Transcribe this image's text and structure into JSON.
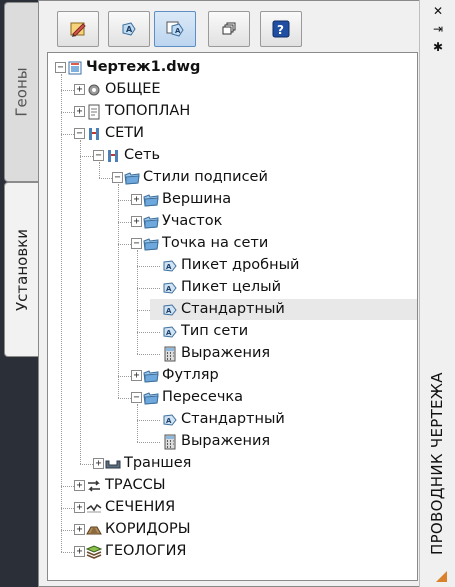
{
  "window": {
    "caption": "ПРОВОДНИК ЧЕРТЕЖА",
    "close_symbol": "✕",
    "autohide_symbol": "⇥",
    "properties_symbol": "✱"
  },
  "side_tabs": [
    {
      "label": "Геоны",
      "active": false
    },
    {
      "label": "Установки",
      "active": true
    }
  ],
  "toolbar": [
    {
      "name": "edit-settings-button",
      "icon": "pencil-drawing-icon",
      "active": false
    },
    {
      "name": "edit-label-style-button",
      "icon": "label-style-icon",
      "active": false
    },
    {
      "name": "label-style-tree-button",
      "icon": "label-style-tree-icon",
      "active": true
    },
    {
      "name": "copy-style-button",
      "icon": "copy-windows-icon",
      "active": false
    },
    {
      "name": "help-button",
      "icon": "help-icon",
      "active": false
    }
  ],
  "tree": {
    "items": [
      {
        "label": "Чертеж1.dwg",
        "level": 0,
        "icon": "drawing-icon",
        "state": "open",
        "bold": true
      },
      {
        "label": "ОБЩЕЕ",
        "level": 1,
        "icon": "gear-icon",
        "state": "closed"
      },
      {
        "label": "ТОПОПЛАН",
        "level": 1,
        "icon": "topoplan-icon",
        "state": "closed"
      },
      {
        "label": "СЕТИ",
        "level": 1,
        "icon": "network-icon",
        "state": "open"
      },
      {
        "label": "Сеть",
        "level": 2,
        "icon": "network-icon",
        "state": "open"
      },
      {
        "label": "Стили подписей",
        "level": 3,
        "icon": "folder-icon",
        "state": "open"
      },
      {
        "label": "Вершина",
        "level": 4,
        "icon": "folder-icon",
        "state": "closed"
      },
      {
        "label": "Участок",
        "level": 4,
        "icon": "folder-icon",
        "state": "closed"
      },
      {
        "label": "Точка на сети",
        "level": 4,
        "icon": "folder-icon",
        "state": "open"
      },
      {
        "label": "Пикет дробный",
        "level": 5,
        "icon": "label-style-icon",
        "state": "leaf"
      },
      {
        "label": "Пикет целый",
        "level": 5,
        "icon": "label-style-icon",
        "state": "leaf"
      },
      {
        "label": "Стандартный",
        "level": 5,
        "icon": "label-style-icon",
        "state": "leaf",
        "selected": true
      },
      {
        "label": "Тип сети",
        "level": 5,
        "icon": "label-style-icon",
        "state": "leaf"
      },
      {
        "label": "Выражения",
        "level": 5,
        "icon": "calculator-icon",
        "state": "leaf"
      },
      {
        "label": "Футляр",
        "level": 4,
        "icon": "folder-icon",
        "state": "closed"
      },
      {
        "label": "Пересечка",
        "level": 4,
        "icon": "folder-icon",
        "state": "open"
      },
      {
        "label": "Стандартный",
        "level": 5,
        "icon": "label-style-icon",
        "state": "leaf"
      },
      {
        "label": "Выражения",
        "level": 5,
        "icon": "calculator-icon",
        "state": "leaf"
      },
      {
        "label": "Траншея",
        "level": 2,
        "icon": "trench-icon",
        "state": "closed"
      },
      {
        "label": "ТРАССЫ",
        "level": 1,
        "icon": "route-icon",
        "state": "closed"
      },
      {
        "label": "СЕЧЕНИЯ",
        "level": 1,
        "icon": "section-icon",
        "state": "closed"
      },
      {
        "label": "КОРИДОРЫ",
        "level": 1,
        "icon": "corridor-icon",
        "state": "closed"
      },
      {
        "label": "ГЕОЛОГИЯ",
        "level": 1,
        "icon": "geology-icon",
        "state": "closed"
      }
    ]
  }
}
